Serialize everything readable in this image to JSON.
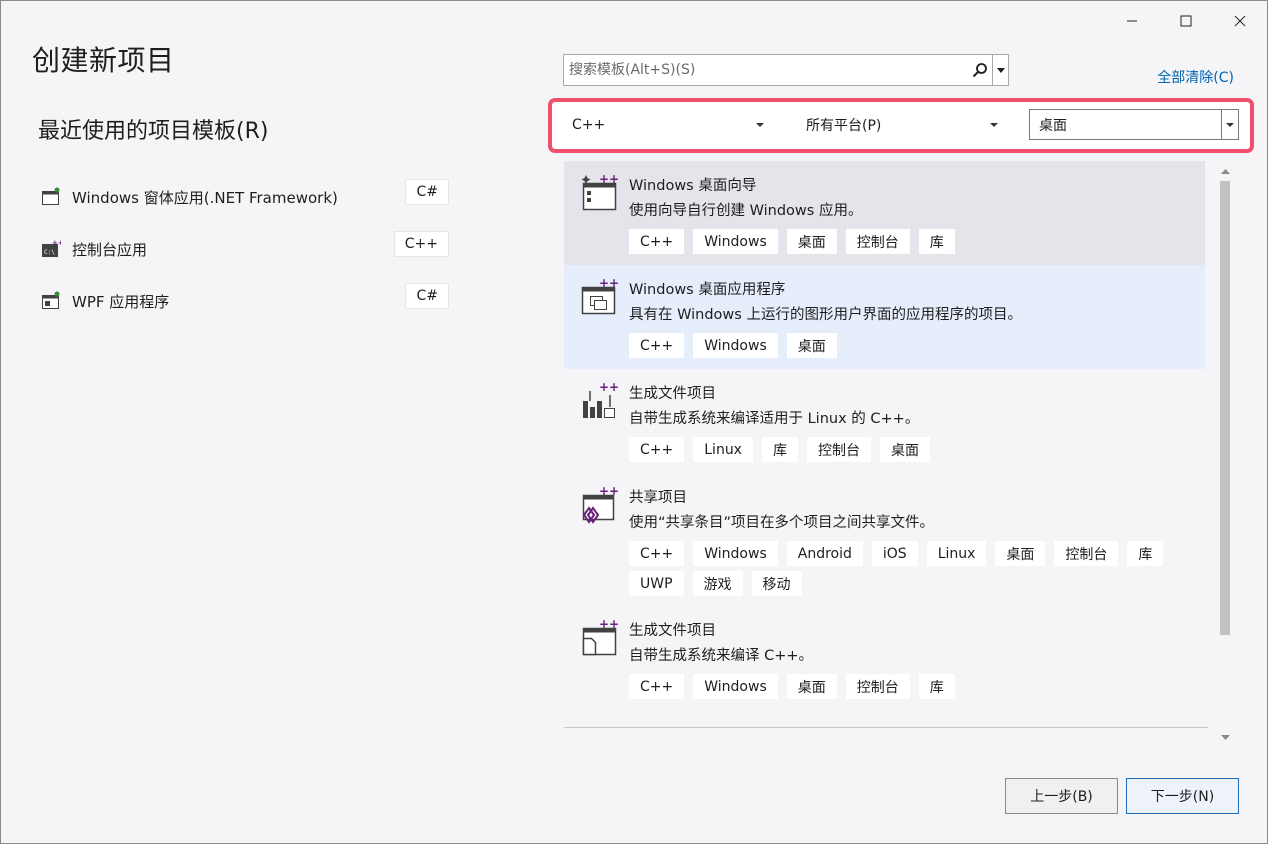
{
  "window": {
    "minimize_icon": "minimize-icon",
    "maximize_icon": "maximize-icon",
    "close_icon": "close-icon"
  },
  "page_title": "创建新项目",
  "recent": {
    "title": "最近使用的项目模板(R)",
    "items": [
      {
        "label": "Windows 窗体应用(.NET Framework)",
        "lang": "C#",
        "icon": "winforms-app-icon"
      },
      {
        "label": "控制台应用",
        "lang": "C++",
        "icon": "console-app-icon"
      },
      {
        "label": "WPF 应用程序",
        "lang": "C#",
        "icon": "wpf-app-icon"
      }
    ]
  },
  "search": {
    "placeholder": "搜索模板(Alt+S)(S)",
    "value": ""
  },
  "clear_all": "全部清除(C)",
  "filters": {
    "language": "C++",
    "platform": "所有平台(P)",
    "project_type": "桌面"
  },
  "templates": [
    {
      "name": "Windows 桌面向导",
      "desc": "使用向导自行创建 Windows 应用。",
      "tags": [
        "C++",
        "Windows",
        "桌面",
        "控制台",
        "库"
      ],
      "icon": "desktop-wizard-icon"
    },
    {
      "name": "Windows 桌面应用程序",
      "desc": "具有在 Windows 上运行的图形用户界面的应用程序的项目。",
      "tags": [
        "C++",
        "Windows",
        "桌面"
      ],
      "icon": "desktop-app-icon"
    },
    {
      "name": "生成文件项目",
      "desc": "自带生成系统来编译适用于 Linux 的 C++。",
      "tags": [
        "C++",
        "Linux",
        "库",
        "控制台",
        "桌面"
      ],
      "icon": "makefile-linux-icon"
    },
    {
      "name": "共享项目",
      "desc": "使用“共享条目”项目在多个项目之间共享文件。",
      "tags": [
        "C++",
        "Windows",
        "Android",
        "iOS",
        "Linux",
        "桌面",
        "控制台",
        "库",
        "UWP",
        "游戏",
        "移动"
      ],
      "icon": "shared-project-icon"
    },
    {
      "name": "生成文件项目",
      "desc": "自带生成系统来编译 C++。",
      "tags": [
        "C++",
        "Windows",
        "桌面",
        "控制台",
        "库"
      ],
      "icon": "makefile-project-icon"
    }
  ],
  "buttons": {
    "prev": "上一步(B)",
    "next": "下一步(N)"
  },
  "colors": {
    "highlight_border": "#f0506e",
    "link": "#0063b1",
    "cpp_purple": "#68217a",
    "selected_bg": "#e4e4ea",
    "hover_bg": "#e6eefc"
  }
}
